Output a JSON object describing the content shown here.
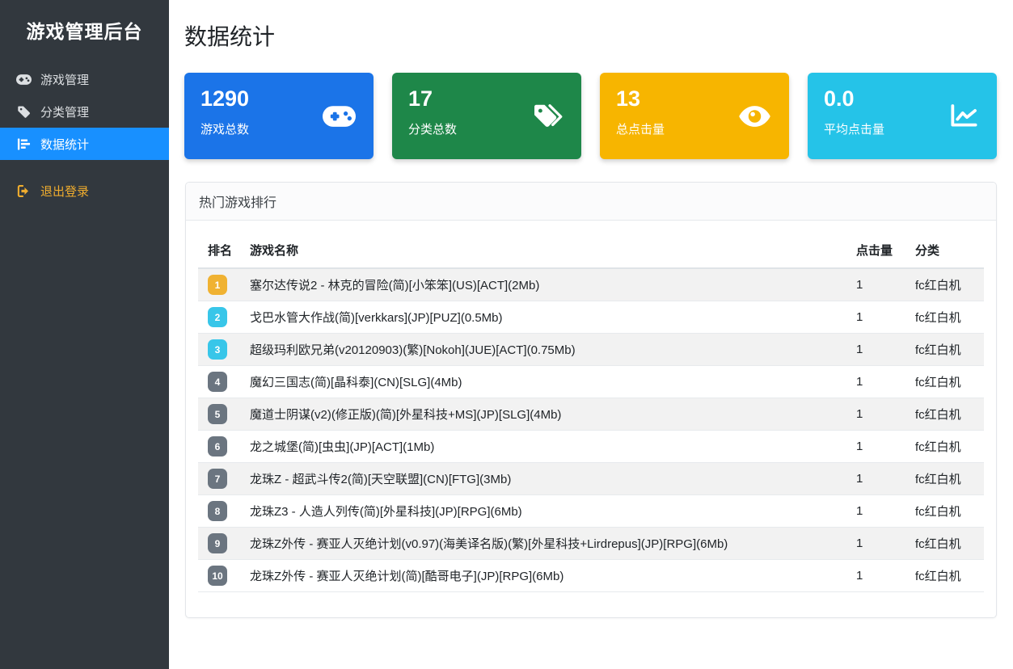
{
  "sidebar": {
    "title": "游戏管理后台",
    "items": [
      {
        "label": "游戏管理",
        "icon": "gamepad-icon",
        "active": false
      },
      {
        "label": "分类管理",
        "icon": "tags-icon",
        "active": false
      },
      {
        "label": "数据统计",
        "icon": "chart-bar-icon",
        "active": true
      }
    ],
    "logout": {
      "label": "退出登录",
      "icon": "sign-out-icon"
    },
    "colors": {
      "bg": "#32383e",
      "active_bg": "#1890ff",
      "logout_text": "#f0ad2e"
    }
  },
  "header": {
    "title": "数据统计"
  },
  "stat_cards": [
    {
      "value": "1290",
      "label": "游戏总数",
      "icon": "gamepad-icon",
      "color": "#1b74e8"
    },
    {
      "value": "17",
      "label": "分类总数",
      "icon": "tags-icon",
      "color": "#1e8749"
    },
    {
      "value": "13",
      "label": "总点击量",
      "icon": "eye-icon",
      "color": "#f7b500"
    },
    {
      "value": "0.0",
      "label": "平均点击量",
      "icon": "chart-line-icon",
      "color": "#25c3e8"
    }
  ],
  "ranking_panel": {
    "title": "热门游戏排行",
    "columns": [
      "排名",
      "游戏名称",
      "点击量",
      "分类"
    ],
    "badge_colors": {
      "1": "#f0b232",
      "2": "#38c6e9",
      "3": "#38c6e9",
      "default": "#6b7580"
    },
    "rows": [
      {
        "rank": "1",
        "name": "塞尔达传说2 - 林克的冒险(简)[小笨笨](US)[ACT](2Mb)",
        "clicks": "1",
        "category": "fc红白机"
      },
      {
        "rank": "2",
        "name": "戈巴水管大作战(简)[verkkars](JP)[PUZ](0.5Mb)",
        "clicks": "1",
        "category": "fc红白机"
      },
      {
        "rank": "3",
        "name": "超级玛利欧兄弟(v20120903)(繁)[Nokoh](JUE)[ACT](0.75Mb)",
        "clicks": "1",
        "category": "fc红白机"
      },
      {
        "rank": "4",
        "name": "魔幻三国志(简)[晶科泰](CN)[SLG](4Mb)",
        "clicks": "1",
        "category": "fc红白机"
      },
      {
        "rank": "5",
        "name": "魔道士阴谋(v2)(修正版)(简)[外星科技+MS](JP)[SLG](4Mb)",
        "clicks": "1",
        "category": "fc红白机"
      },
      {
        "rank": "6",
        "name": "龙之城堡(简)[虫虫](JP)[ACT](1Mb)",
        "clicks": "1",
        "category": "fc红白机"
      },
      {
        "rank": "7",
        "name": "龙珠Z - 超武斗传2(简)[天空联盟](CN)[FTG](3Mb)",
        "clicks": "1",
        "category": "fc红白机"
      },
      {
        "rank": "8",
        "name": "龙珠Z3 - 人造人列传(简)[外星科技](JP)[RPG](6Mb)",
        "clicks": "1",
        "category": "fc红白机"
      },
      {
        "rank": "9",
        "name": "龙珠Z外传 - 赛亚人灭绝计划(v0.97)(海美译名版)(繁)[外星科技+Lirdrepus](JP)[RPG](6Mb)",
        "clicks": "1",
        "category": "fc红白机"
      },
      {
        "rank": "10",
        "name": "龙珠Z外传 - 赛亚人灭绝计划(简)[酷哥电子](JP)[RPG](6Mb)",
        "clicks": "1",
        "category": "fc红白机"
      }
    ]
  }
}
